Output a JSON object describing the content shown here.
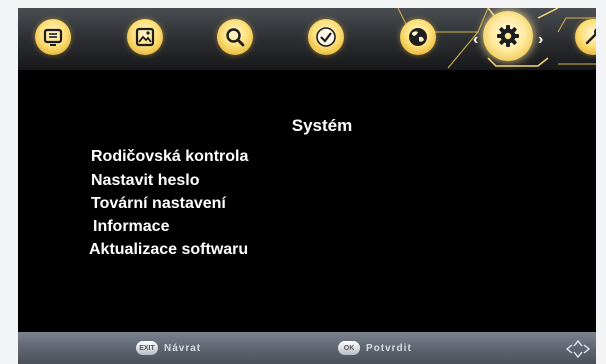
{
  "header": {
    "tabs": [
      {
        "name": "tv-icon",
        "active": false
      },
      {
        "name": "picture-icon",
        "active": false
      },
      {
        "name": "search-icon",
        "active": false
      },
      {
        "name": "clock-icon",
        "active": false
      },
      {
        "name": "globe-icon",
        "active": false
      },
      {
        "name": "gear-icon",
        "active": true
      },
      {
        "name": "tools-icon",
        "active": false
      }
    ]
  },
  "main": {
    "title": "Systém",
    "items": [
      {
        "label": "Rodičovská kontrola"
      },
      {
        "label": "Nastavit heslo"
      },
      {
        "label": "Tovární nastavení"
      },
      {
        "label": "Informace"
      },
      {
        "label": "Aktualizace softwaru"
      }
    ]
  },
  "footer": {
    "back_key": "EXIT",
    "back_label": "Návrat",
    "ok_key": "OK",
    "ok_label": "Potvrdit"
  },
  "colors": {
    "accent": "#ffd84a",
    "background": "#000000",
    "text": "#ffffff",
    "footer": "#5f6671"
  }
}
